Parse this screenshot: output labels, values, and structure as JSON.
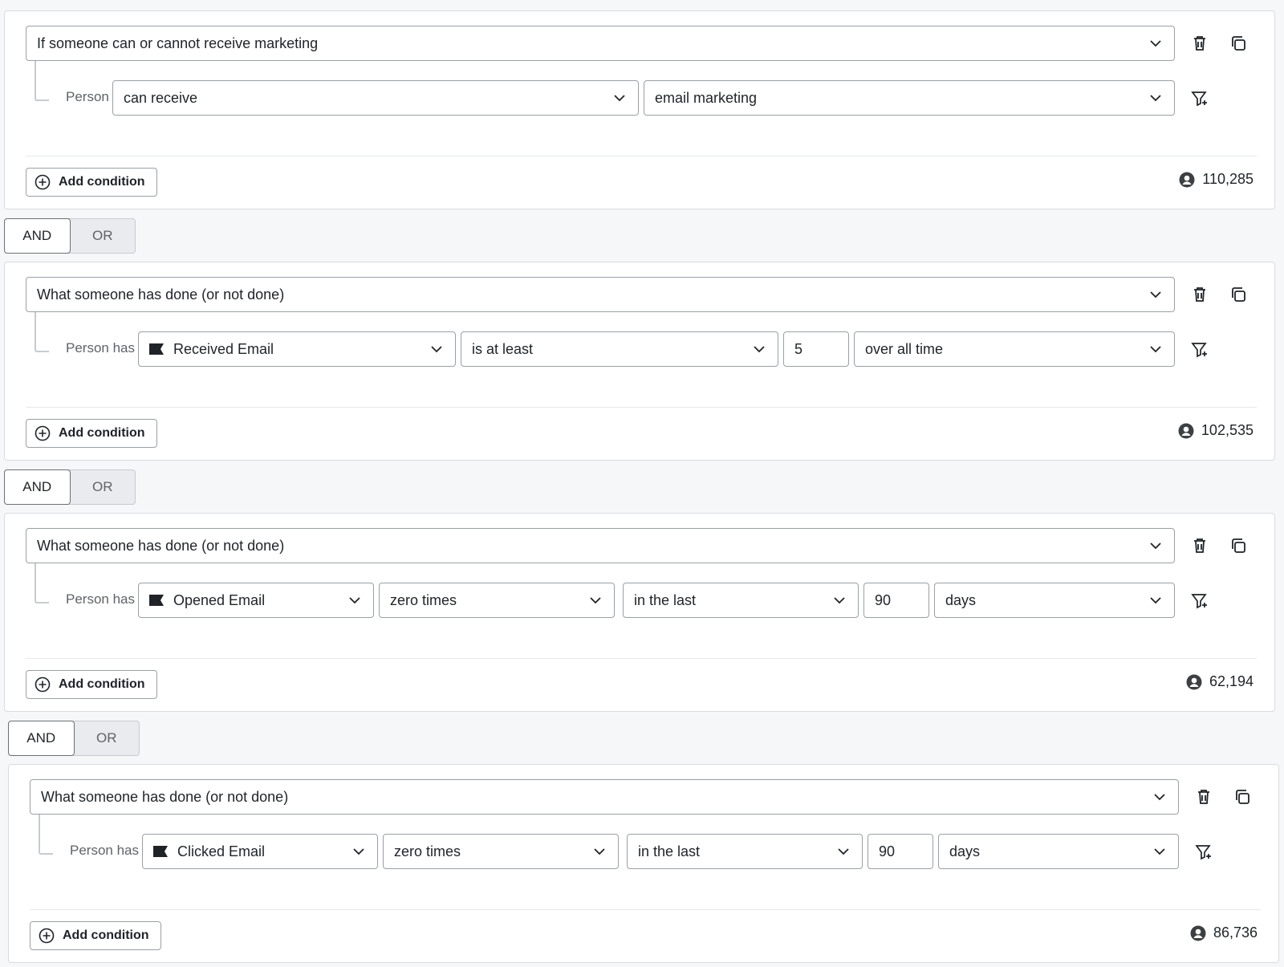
{
  "blocks": [
    {
      "type_label": "If someone can or cannot receive marketing",
      "person_label": "Person",
      "selects": [
        "can receive",
        "email marketing"
      ],
      "add_condition_label": "Add condition",
      "count": "110,285"
    },
    {
      "type_label": "What someone has done (or not done)",
      "person_label": "Person has",
      "metric": "Received Email",
      "operator": "is at least",
      "value": "5",
      "timeframe": "over all time",
      "add_condition_label": "Add condition",
      "count": "102,535"
    },
    {
      "type_label": "What someone has done (or not done)",
      "person_label": "Person has",
      "metric": "Opened Email",
      "operator": "zero times",
      "timeframe": "in the last",
      "value": "90",
      "unit": "days",
      "add_condition_label": "Add condition",
      "count": "62,194"
    },
    {
      "type_label": "What someone has done (or not done)",
      "person_label": "Person has",
      "metric": "Clicked Email",
      "operator": "zero times",
      "timeframe": "in the last",
      "value": "90",
      "unit": "days",
      "add_condition_label": "Add condition",
      "count": "86,736"
    }
  ],
  "toggles": [
    {
      "and": "AND",
      "or": "OR",
      "selected": "AND"
    },
    {
      "and": "AND",
      "or": "OR",
      "selected": "AND"
    },
    {
      "and": "AND",
      "or": "OR",
      "selected": "AND"
    }
  ],
  "icons": {
    "delete": "trash-icon",
    "duplicate": "copy-icon",
    "filter": "filter-add-icon",
    "person": "person-circle-icon",
    "metric": "flag-icon",
    "add": "plus-circle-icon",
    "chevron": "chevron-down-icon"
  }
}
